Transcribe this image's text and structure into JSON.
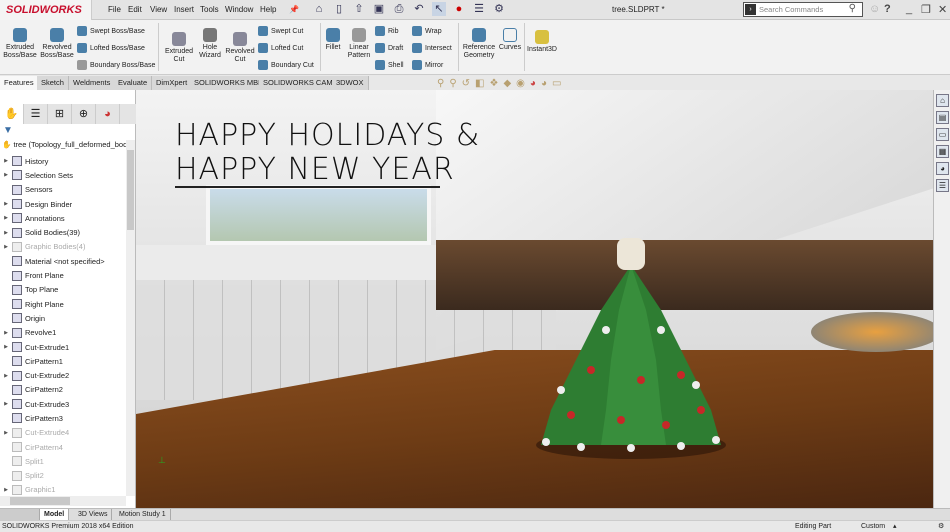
{
  "app": {
    "logo": "SOLIDWORKS",
    "document_title": "tree.SLDPRT *",
    "brand_color": "#c8102e"
  },
  "menu": [
    "File",
    "Edit",
    "View",
    "Insert",
    "Tools",
    "Window",
    "Help"
  ],
  "search": {
    "placeholder": "Search Commands"
  },
  "ribbon": {
    "large": [
      "Extruded Boss/Base",
      "Revolved Boss/Base",
      "Extruded Cut",
      "Hole Wizard",
      "Revolved Cut",
      "Fillet",
      "Linear Pattern",
      "Reference Geometry",
      "Curves",
      "Instant3D"
    ],
    "small": [
      "Swept Boss/Base",
      "Lofted Boss/Base",
      "Boundary Boss/Base",
      "Swept Cut",
      "Lofted Cut",
      "Boundary Cut",
      "Rib",
      "Draft",
      "Shell",
      "Wrap",
      "Intersect",
      "Mirror"
    ]
  },
  "tabs": [
    "Features",
    "Sketch",
    "Weldments",
    "Evaluate",
    "DimXpert",
    "SOLIDWORKS MBD",
    "SOLIDWORKS CAM",
    "3DWOX"
  ],
  "feature_tree": {
    "root": "tree  (Topology_full_deformed_bod",
    "items": [
      {
        "label": "History",
        "expand": true,
        "dim": false
      },
      {
        "label": "Selection Sets",
        "expand": true,
        "dim": false
      },
      {
        "label": "Sensors",
        "expand": false,
        "dim": false
      },
      {
        "label": "Design Binder",
        "expand": true,
        "dim": false
      },
      {
        "label": "Annotations",
        "expand": true,
        "dim": false
      },
      {
        "label": "Solid Bodies(39)",
        "expand": true,
        "dim": false
      },
      {
        "label": "Graphic Bodies(4)",
        "expand": true,
        "dim": true
      },
      {
        "label": "Material <not specified>",
        "expand": false,
        "dim": false
      },
      {
        "label": "Front Plane",
        "expand": false,
        "dim": false
      },
      {
        "label": "Top Plane",
        "expand": false,
        "dim": false
      },
      {
        "label": "Right Plane",
        "expand": false,
        "dim": false
      },
      {
        "label": "Origin",
        "expand": false,
        "dim": false
      },
      {
        "label": "Revolve1",
        "expand": true,
        "dim": false
      },
      {
        "label": "Cut-Extrude1",
        "expand": true,
        "dim": false
      },
      {
        "label": "CirPattern1",
        "expand": false,
        "dim": false
      },
      {
        "label": "Cut-Extrude2",
        "expand": true,
        "dim": false
      },
      {
        "label": "CirPattern2",
        "expand": false,
        "dim": false
      },
      {
        "label": "Cut-Extrude3",
        "expand": true,
        "dim": false
      },
      {
        "label": "CirPattern3",
        "expand": false,
        "dim": false
      },
      {
        "label": "Cut-Extrude4",
        "expand": true,
        "dim": true
      },
      {
        "label": "CirPattern4",
        "expand": false,
        "dim": true
      },
      {
        "label": "Split1",
        "expand": false,
        "dim": true
      },
      {
        "label": "Split2",
        "expand": false,
        "dim": true
      },
      {
        "label": "Graphic1",
        "expand": true,
        "dim": true
      }
    ]
  },
  "viewport": {
    "line1": "HAPPY HOLIDAYS &",
    "line2": "HAPPY NEW YEAR",
    "tree_color": "#2e7d32"
  },
  "bottom_tabs": [
    "Model",
    "3D Views",
    "Motion Study 1"
  ],
  "status": {
    "edition": "SOLIDWORKS Premium 2018 x64 Edition",
    "mode": "Editing Part",
    "units": "Custom"
  }
}
